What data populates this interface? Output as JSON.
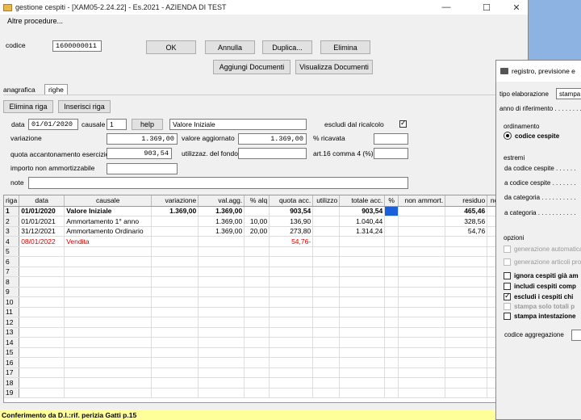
{
  "window": {
    "title": "gestione cespiti - [XAM05-2.24.22] - Es.2021 - AZIENDA DI TEST",
    "minimize": "—",
    "maximize": "☐",
    "close": "✕"
  },
  "menu": {
    "item": "Altre procedure..."
  },
  "header": {
    "codice_label": "codice",
    "codice_value": "1600000011",
    "ok": "OK",
    "annulla": "Annulla",
    "duplica": "Duplica...",
    "elimina": "Elimina",
    "aggiungi_documenti": "Aggiungi Documenti",
    "visualizza_documenti": "Visualizza Documenti"
  },
  "tabs": {
    "anagrafica": "anagrafica",
    "righe": "righe"
  },
  "row_buttons": {
    "elimina_riga": "Elimina riga",
    "inserisci_riga": "Inserisci riga"
  },
  "form": {
    "data_label": "data",
    "data_value": "01/01/2020",
    "causale_label": "causale",
    "causale_value": "1",
    "help": "help",
    "causale_desc": "Valore Iniziale",
    "escludi_label": "escludi dal ricalcolo",
    "variazione_label": "variazione",
    "variazione_value": "1.369,00",
    "valore_aggiornato_label": "valore aggiornato",
    "valore_aggiornato_value": "1.369,00",
    "ricavata_label": "% ricavata",
    "ricavata_value": "",
    "quota_label": "quota accantonamento esercizio",
    "quota_value": "903,54",
    "utilizzaz_label": "utilizzaz. del fondo",
    "utilizzaz_value": "",
    "art16_label": "art.16 comma 4 (%)",
    "art16_value": "",
    "importo_label": "importo non ammortizzabile",
    "importo_value": "",
    "note_label": "note",
    "note_value": ""
  },
  "grid": {
    "columns": [
      "riga",
      "data",
      "causale",
      "variazione",
      "val.agg.",
      "% alq",
      "quota acc.",
      "utilizzo",
      "totale acc.",
      "%",
      "non ammort.",
      "residuo",
      "note"
    ],
    "rows": [
      {
        "n": "1",
        "data": "01/01/2020",
        "causale": "Valore Iniziale",
        "variazione": "1.369,00",
        "valagg": "1.369,00",
        "alq": "",
        "quota": "903,54",
        "utilizzo": "",
        "totale": "903,54",
        "pct": "",
        "nonammort": "",
        "residuo": "465,46",
        "note": "",
        "style": "bold"
      },
      {
        "n": "2",
        "data": "01/01/2021",
        "causale": "Ammortamento 1° anno",
        "variazione": "",
        "valagg": "1.369,00",
        "alq": "10,00",
        "quota": "136,90",
        "utilizzo": "",
        "totale": "1.040,44",
        "pct": "",
        "nonammort": "",
        "residuo": "328,56",
        "note": "",
        "style": ""
      },
      {
        "n": "3",
        "data": "31/12/2021",
        "causale": "Ammortamento Ordinario",
        "variazione": "",
        "valagg": "1.369,00",
        "alq": "20,00",
        "quota": "273,80",
        "utilizzo": "",
        "totale": "1.314,24",
        "pct": "",
        "nonammort": "",
        "residuo": "54,76",
        "note": "",
        "style": ""
      },
      {
        "n": "4",
        "data": "08/01/2022",
        "causale": "Vendita",
        "variazione": "",
        "valagg": "",
        "alq": "",
        "quota": "54,76-",
        "utilizzo": "",
        "totale": "",
        "pct": "",
        "nonammort": "",
        "residuo": "",
        "note": "",
        "style": "red"
      }
    ],
    "empty_rows": [
      "5",
      "6",
      "7",
      "8",
      "9",
      "10",
      "11",
      "12",
      "13",
      "14",
      "15",
      "16",
      "17",
      "18",
      "19"
    ]
  },
  "status": {
    "text": "Conferimento da D.I.:rif. perizia Gatti p.15"
  },
  "dialog": {
    "title": "registro, previsione e",
    "tipo_label": "tipo elaborazione",
    "tipo_value": "stampa",
    "anno_label": "anno di riferimento . . . . . . . .",
    "ordinamento_label": "ordinamento",
    "codice_cespite_radio": "codice cespite",
    "estremi_label": "estremi",
    "da_codice": "da codice cespite . . . . . .",
    "a_codice": "a codice cespite . . . . . . .",
    "da_categoria": "da categoria . . . . . . . . . .",
    "a_categoria": "a categoria . . . . . . . . . . .",
    "opzioni_label": "opzioni",
    "gen_auto": "generazione automatica",
    "gen_articoli": "generazione articoli prov",
    "ignora": "ignora cespiti già am",
    "includi": "includi cespiti comp",
    "escludi": "escludi i cespiti chi",
    "stampa_totali": "stampa solo totali p",
    "stampa_intest": "stampa intestazione",
    "codice_aggr": "codice aggregazione"
  },
  "colors": {
    "accent": "#1a5fd8",
    "status_bg": "#ffff99",
    "red": "#e00000"
  }
}
